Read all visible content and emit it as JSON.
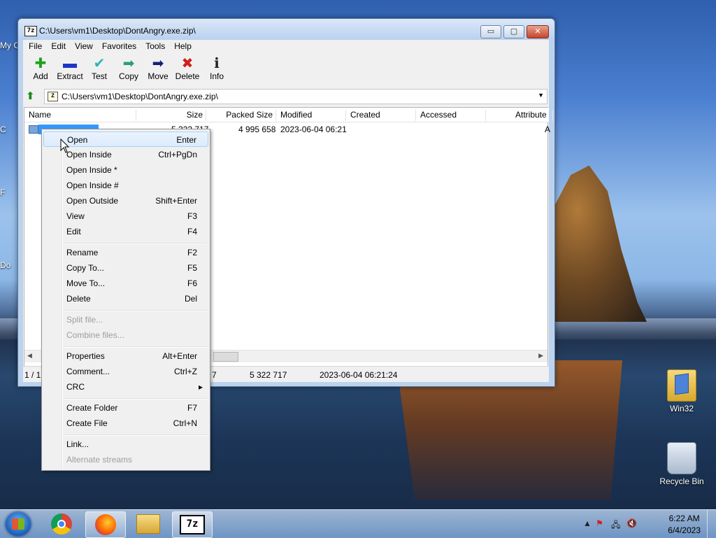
{
  "window": {
    "title": "C:\\Users\\vm1\\Desktop\\DontAngry.exe.zip\\",
    "app_icon": "7z",
    "controls": {
      "minimize": "▭",
      "maximize": "▢",
      "close": "✕"
    }
  },
  "menu": [
    "File",
    "Edit",
    "View",
    "Favorites",
    "Tools",
    "Help"
  ],
  "toolbar": [
    {
      "label": "Add",
      "icon": "plus-icon",
      "glyph": "✚",
      "color": "#1aa31a"
    },
    {
      "label": "Extract",
      "icon": "minus-icon",
      "glyph": "▬",
      "color": "#1d35c7"
    },
    {
      "label": "Test",
      "icon": "check-icon",
      "glyph": "✔",
      "color": "#2bb5b5"
    },
    {
      "label": "Copy",
      "icon": "arrow-right-icon",
      "glyph": "➡",
      "color": "#2a9d7a"
    },
    {
      "label": "Move",
      "icon": "arrow-right-icon",
      "glyph": "➡",
      "color": "#13207a"
    },
    {
      "label": "Delete",
      "icon": "x-icon",
      "glyph": "✖",
      "color": "#d21d1d"
    },
    {
      "label": "Info",
      "icon": "info-icon",
      "glyph": "ℹ",
      "color": "#222222"
    }
  ],
  "address": {
    "path": "C:\\Users\\vm1\\Desktop\\DontAngry.exe.zip\\",
    "dropdown": "▼",
    "up": "⬆"
  },
  "columns": [
    "Name",
    "Size",
    "Packed Size",
    "Modified",
    "Created",
    "Accessed",
    "Attribute"
  ],
  "rows": [
    {
      "name": "",
      "size": "5 322 717",
      "packed": "4 995 658",
      "modified": "2023-06-04 06:21",
      "attr": "A"
    }
  ],
  "status": {
    "count": "1 / 1",
    "size_tail": "7",
    "size": "5 322 717",
    "date": "2023-06-04 06:21:24"
  },
  "scroll": {
    "left": "◀",
    "right": "▶"
  },
  "context_menu": [
    {
      "label": "Open",
      "key": "Enter",
      "hot": true
    },
    {
      "label": "Open Inside",
      "key": "Ctrl+PgDn"
    },
    {
      "label": "Open Inside *",
      "key": ""
    },
    {
      "label": "Open Inside #",
      "key": ""
    },
    {
      "label": "Open Outside",
      "key": "Shift+Enter"
    },
    {
      "label": "View",
      "key": "F3"
    },
    {
      "label": "Edit",
      "key": "F4"
    },
    {
      "label": "Rename",
      "key": "F2"
    },
    {
      "label": "Copy To...",
      "key": "F5"
    },
    {
      "label": "Move To...",
      "key": "F6"
    },
    {
      "label": "Delete",
      "key": "Del"
    },
    {
      "label": "Split file...",
      "key": "",
      "disabled": true
    },
    {
      "label": "Combine files...",
      "key": "",
      "disabled": true
    },
    {
      "label": "Properties",
      "key": "Alt+Enter"
    },
    {
      "label": "Comment...",
      "key": "Ctrl+Z"
    },
    {
      "label": "CRC",
      "key": "▸"
    },
    {
      "label": "Create Folder",
      "key": "F7"
    },
    {
      "label": "Create File",
      "key": "Ctrl+N"
    },
    {
      "label": "Link...",
      "key": ""
    },
    {
      "label": "Alternate streams",
      "key": "",
      "disabled": true
    }
  ],
  "desktop": {
    "left_labels": [
      "My C",
      "C",
      "F",
      "Do"
    ],
    "icons": [
      {
        "label": "Win32",
        "icon": "folder-icon"
      },
      {
        "label": "Recycle Bin",
        "icon": "recycle-bin-icon"
      }
    ]
  },
  "taskbar": {
    "apps": [
      "chrome-icon",
      "firefox-icon",
      "explorer-icon",
      "7zip-icon"
    ],
    "active_label": "7z",
    "tray": {
      "chevron": "▲",
      "flag": "⚑",
      "network": "🖧",
      "volume": "🔇"
    },
    "time": "6:22 AM",
    "date": "6/4/2023"
  }
}
